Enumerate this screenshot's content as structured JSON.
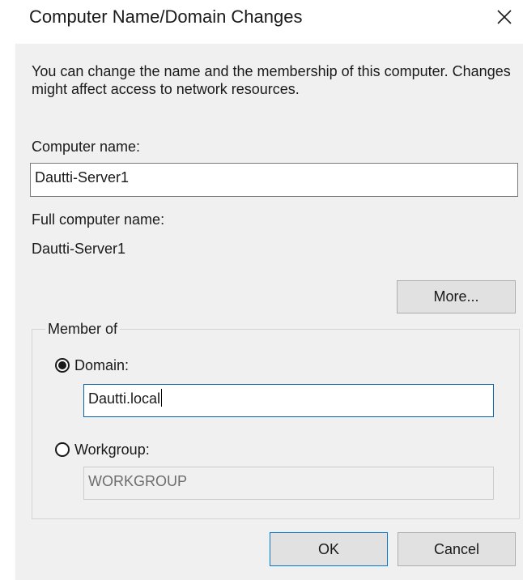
{
  "window": {
    "title": "Computer Name/Domain Changes",
    "close_icon": "close-icon"
  },
  "description": "You can change the name and the membership of this computer. Changes might affect access to network resources.",
  "computer_name": {
    "label": "Computer name:",
    "value": "Dautti-Server1"
  },
  "full_computer_name": {
    "label": "Full computer name:",
    "value": "Dautti-Server1"
  },
  "more_button": "More...",
  "member_of": {
    "label": "Member of",
    "selected": "domain",
    "domain": {
      "label": "Domain:",
      "value": "Dautti.local"
    },
    "workgroup": {
      "label": "Workgroup:",
      "value": "WORKGROUP"
    }
  },
  "buttons": {
    "ok": "OK",
    "cancel": "Cancel"
  },
  "colors": {
    "dialog_background": "#f0f0f0",
    "focus_border": "#0078d7",
    "input_focus_border": "#0a64ad"
  }
}
